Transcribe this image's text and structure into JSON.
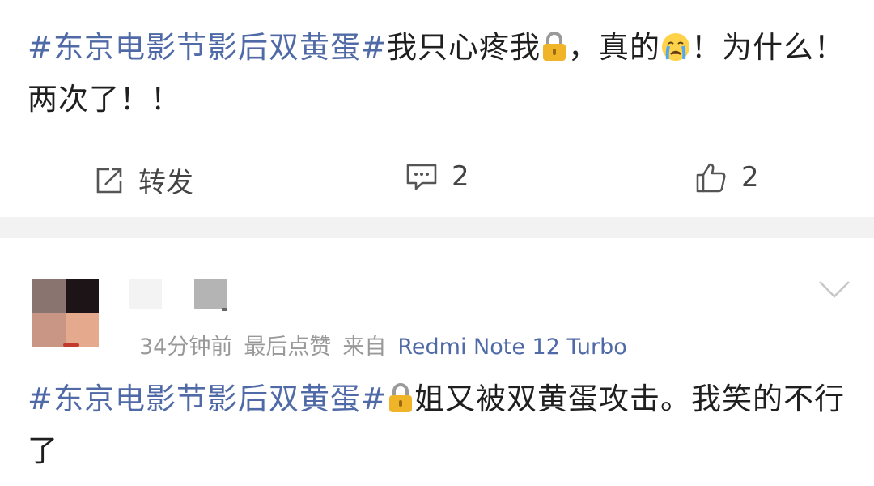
{
  "post": {
    "hashtag": "#东京电影节影后双黄蛋#",
    "text_before_lock": "我只心疼我",
    "text_after_lock": "，真的",
    "text_after_emoji": "！为什么！两次了！！",
    "icons": [
      "lock-emoji",
      "crying-face-emoji"
    ]
  },
  "actions": {
    "repost_label": "转发",
    "comment_count": "2",
    "like_count": "2",
    "icons": [
      "repost-icon",
      "comment-icon",
      "like-icon"
    ]
  },
  "comment": {
    "time": "34分钟前",
    "status": "最后点赞",
    "source_prefix": "来自",
    "device": "Redmi Note 12 Turbo",
    "hashtag": "#东京电影节影后双黄蛋#",
    "text": "姐又被双黄蛋攻击。我笑的不行了",
    "icons": [
      "lock-emoji",
      "chevron-down-icon"
    ]
  },
  "colors": {
    "hashtag": "#4f6aa6",
    "text": "#1f1f1f",
    "meta": "#999999",
    "separator": "#f2f2f2"
  }
}
